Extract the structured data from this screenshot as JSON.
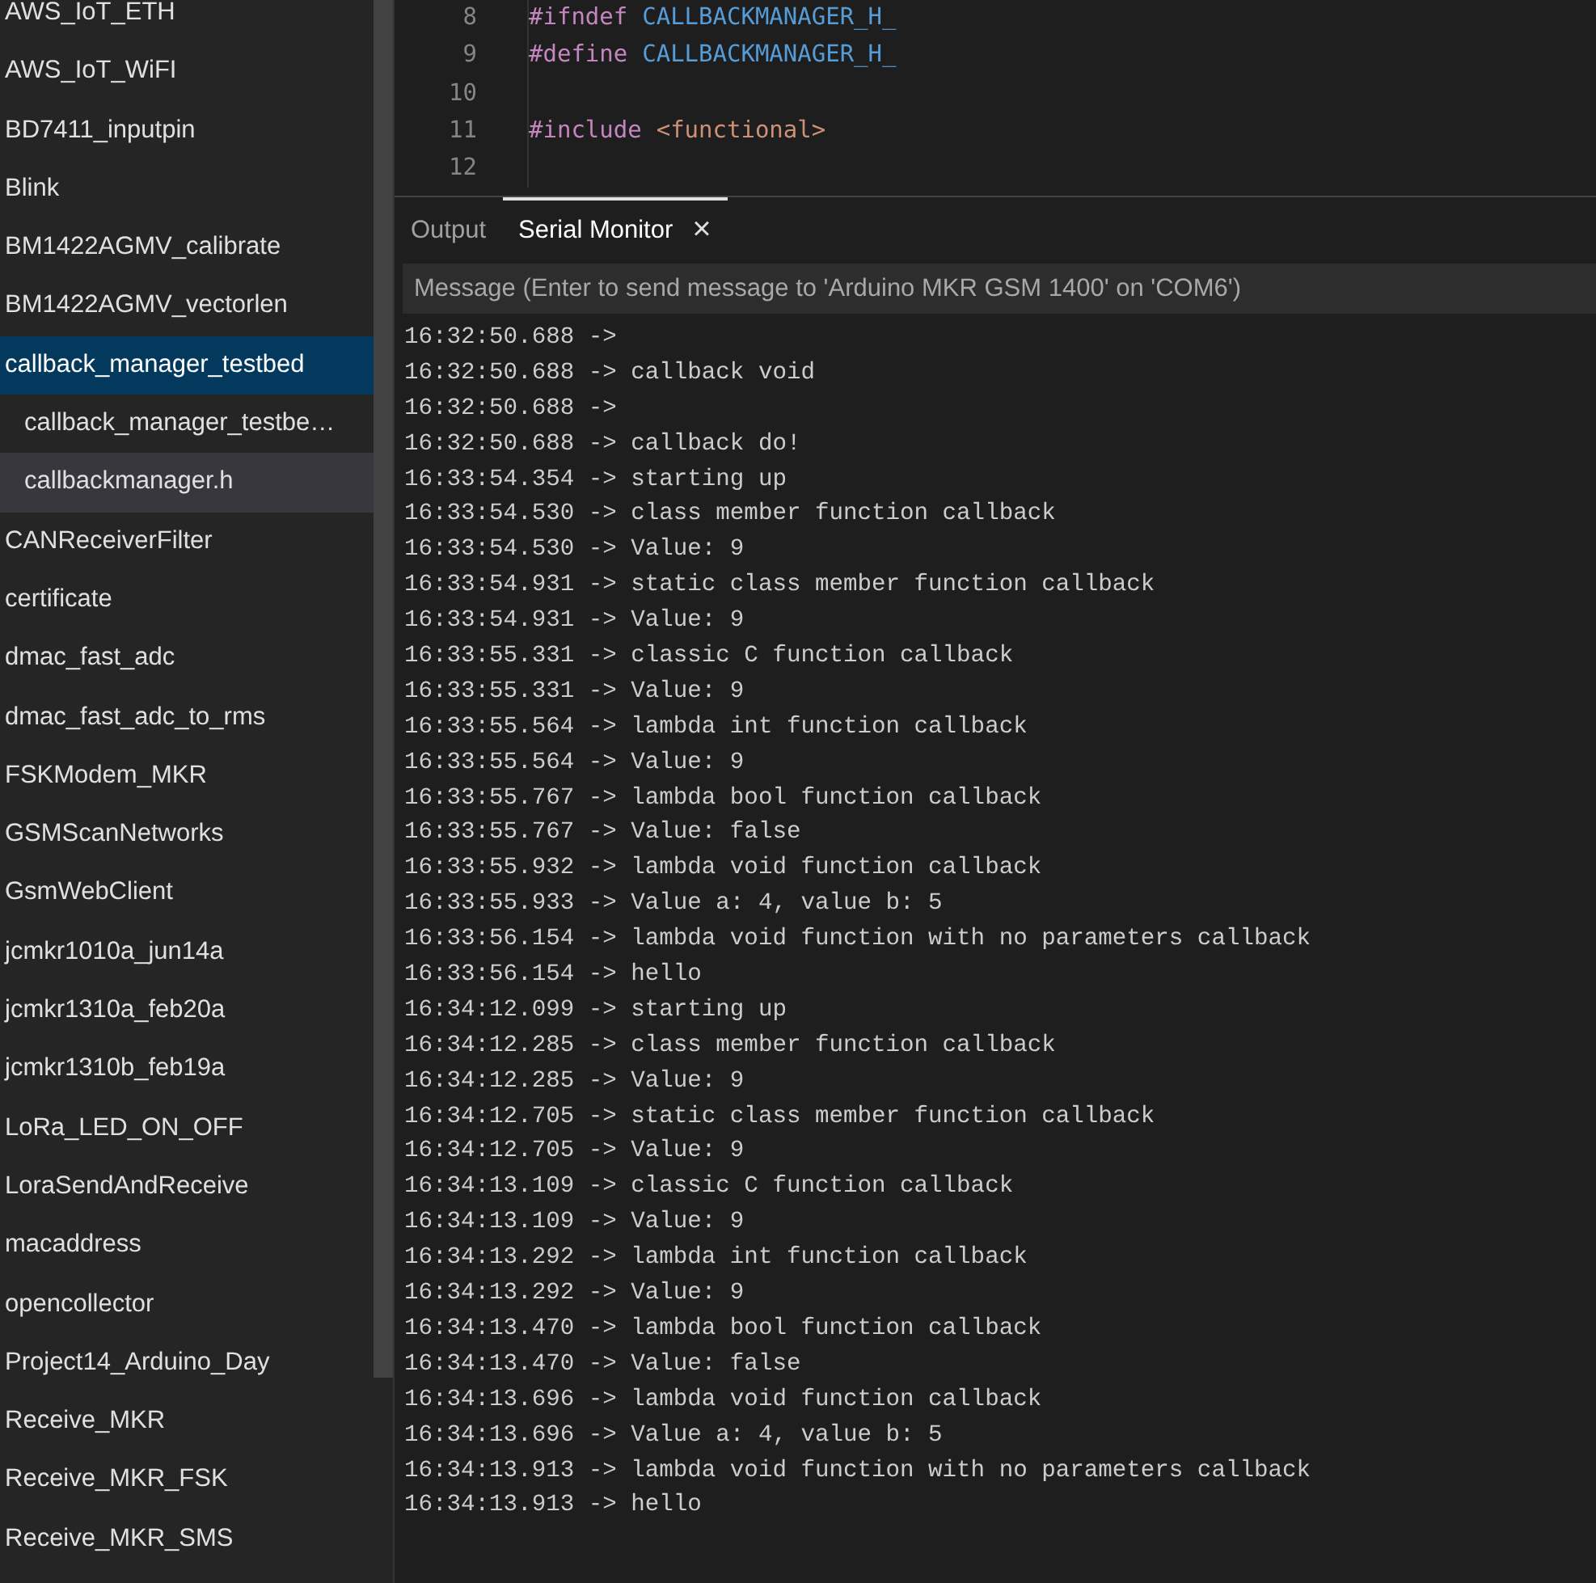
{
  "sidebar": {
    "items": [
      {
        "label": "AWS_IoT_ETH",
        "selected": false
      },
      {
        "label": "AWS_IoT_WiFI",
        "selected": false
      },
      {
        "label": "BD7411_inputpin",
        "selected": false
      },
      {
        "label": "Blink",
        "selected": false
      },
      {
        "label": "BM1422AGMV_calibrate",
        "selected": false
      },
      {
        "label": "BM1422AGMV_vectorlen",
        "selected": false
      },
      {
        "label": "callback_manager_testbed",
        "selected": true,
        "children": [
          {
            "label": "callback_manager_testbe…",
            "selected": false
          },
          {
            "label": "callbackmanager.h",
            "selected": true
          }
        ]
      },
      {
        "label": "CANReceiverFilter",
        "selected": false
      },
      {
        "label": "certificate",
        "selected": false
      },
      {
        "label": "dmac_fast_adc",
        "selected": false
      },
      {
        "label": "dmac_fast_adc_to_rms",
        "selected": false
      },
      {
        "label": "FSKModem_MKR",
        "selected": false
      },
      {
        "label": "GSMScanNetworks",
        "selected": false
      },
      {
        "label": "GsmWebClient",
        "selected": false
      },
      {
        "label": "jcmkr1010a_jun14a",
        "selected": false
      },
      {
        "label": "jcmkr1310a_feb20a",
        "selected": false
      },
      {
        "label": "jcmkr1310b_feb19a",
        "selected": false
      },
      {
        "label": "LoRa_LED_ON_OFF",
        "selected": false
      },
      {
        "label": "LoraSendAndReceive",
        "selected": false
      },
      {
        "label": "macaddress",
        "selected": false
      },
      {
        "label": "opencollector",
        "selected": false
      },
      {
        "label": "Project14_Arduino_Day",
        "selected": false
      },
      {
        "label": "Receive_MKR",
        "selected": false
      },
      {
        "label": "Receive_MKR_FSK",
        "selected": false
      },
      {
        "label": "Receive_MKR_SMS",
        "selected": false
      }
    ]
  },
  "editor": {
    "lines": [
      {
        "number": "8",
        "tokens": [
          {
            "kind": "directive",
            "text": "#ifndef"
          },
          {
            "kind": "macro",
            "text": "CALLBACKMANAGER_H_"
          }
        ]
      },
      {
        "number": "9",
        "tokens": [
          {
            "kind": "directive",
            "text": "#define"
          },
          {
            "kind": "macro",
            "text": "CALLBACKMANAGER_H_"
          }
        ]
      },
      {
        "number": "10"
      },
      {
        "number": "11",
        "tokens": [
          {
            "kind": "directive",
            "text": "#include"
          },
          {
            "kind": "string",
            "text": "<functional>"
          }
        ]
      },
      {
        "number": "12"
      }
    ]
  },
  "panel": {
    "tabs": [
      {
        "label": "Output",
        "selected": false,
        "closable": false
      },
      {
        "label": "Serial Monitor",
        "selected": true,
        "closable": true,
        "close": "×"
      }
    ],
    "message": {
      "placeholder": "Message (Enter to send message to 'Arduino MKR GSM 1400' on 'COM6')"
    },
    "log": [
      "16:32:50.688 ->",
      "16:32:50.688 -> callback void",
      "16:32:50.688 ->",
      "16:32:50.688 -> callback do!",
      "16:33:54.354 -> starting up",
      "16:33:54.530 -> class member function callback",
      "16:33:54.530 -> Value: 9",
      "16:33:54.931 -> static class member function callback",
      "16:33:54.931 -> Value: 9",
      "16:33:55.331 -> classic C function callback",
      "16:33:55.331 -> Value: 9",
      "16:33:55.564 -> lambda int function callback",
      "16:33:55.564 -> Value: 9",
      "16:33:55.767 -> lambda bool function callback",
      "16:33:55.767 -> Value: false",
      "16:33:55.932 -> lambda void function callback",
      "16:33:55.933 -> Value a: 4, value b: 5",
      "16:33:56.154 -> lambda void function with no parameters callback",
      "16:33:56.154 -> hello",
      "16:34:12.099 -> starting up",
      "16:34:12.285 -> class member function callback",
      "16:34:12.285 -> Value: 9",
      "16:34:12.705 -> static class member function callback",
      "16:34:12.705 -> Value: 9",
      "16:34:13.109 -> classic C function callback",
      "16:34:13.109 -> Value: 9",
      "16:34:13.292 -> lambda int function callback",
      "16:34:13.292 -> Value: 9",
      "16:34:13.470 -> lambda bool function callback",
      "16:34:13.470 -> Value: false",
      "16:34:13.696 -> lambda void function callback",
      "16:34:13.696 -> Value a: 4, value b: 5",
      "16:34:13.913 -> lambda void function with no parameters callback",
      "16:34:13.913 -> hello"
    ]
  }
}
